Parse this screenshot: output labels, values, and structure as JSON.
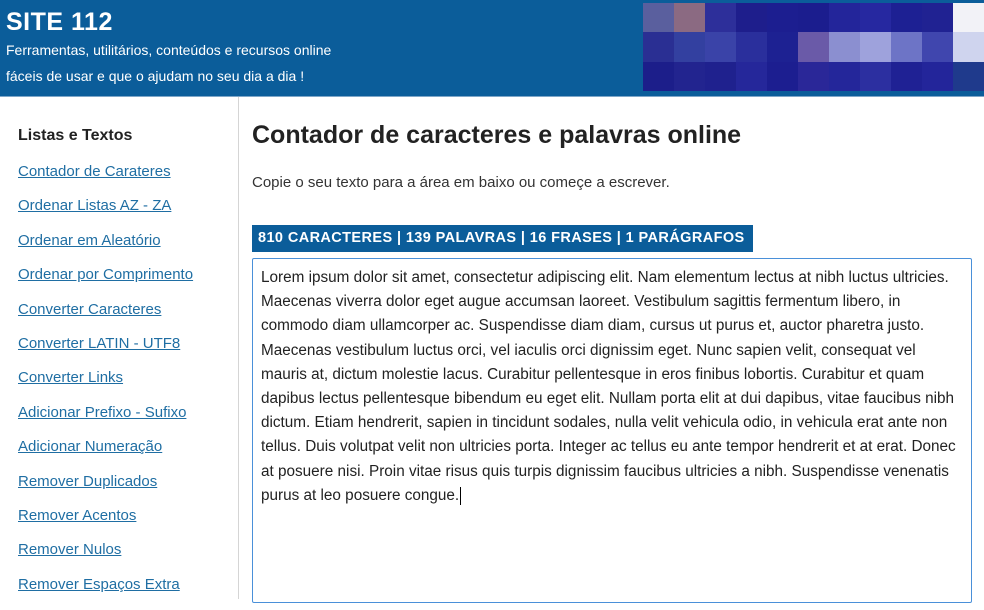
{
  "header": {
    "site_title": "SITE 112",
    "tagline_line1": "Ferramentas, utilitários, conteúdos e recursos online",
    "tagline_line2": "fáceis de usar e que o ajudam no seu dia a dia !",
    "colors": {
      "background": "#0b5d9a",
      "text": "#ffffff"
    }
  },
  "sidebar": {
    "heading": "Listas e Textos",
    "items": [
      {
        "label": "Contador de Carateres"
      },
      {
        "label": "Ordenar Listas AZ - ZA"
      },
      {
        "label": "Ordenar em Aleatório"
      },
      {
        "label": "Ordenar por Comprimento"
      },
      {
        "label": "Converter Caracteres"
      },
      {
        "label": "Converter LATIN - UTF8"
      },
      {
        "label": "Converter Links"
      },
      {
        "label": "Adicionar Prefixo - Sufixo"
      },
      {
        "label": "Adicionar Numeração"
      },
      {
        "label": "Remover Duplicados"
      },
      {
        "label": "Remover Acentos"
      },
      {
        "label": "Remover Nulos"
      },
      {
        "label": "Remover Espaços Extra"
      }
    ],
    "link_color": "#1f6ea3"
  },
  "main": {
    "title": "Contador de caracteres e palavras online",
    "subtitle": "Copie o seu texto para a área em baixo ou começe a escrever.",
    "stats": "810 CARACTERES | 139 PALAVRAS | 16 FRASES | 1 PARÁGRAFOS",
    "editor_text": "Lorem ipsum dolor sit amet, consectetur adipiscing elit. Nam elementum lectus at nibh luctus ultricies. Maecenas viverra dolor eget augue accumsan laoreet. Vestibulum sagittis fermentum libero, in commodo diam ullamcorper ac. Suspendisse diam diam, cursus ut purus et, auctor pharetra justo. Maecenas vestibulum luctus orci, vel iaculis orci dignissim eget. Nunc sapien velit, consequat vel mauris at, dictum molestie lacus. Curabitur pellentesque in eros finibus lobortis. Curabitur et quam dapibus lectus pellentesque bibendum eu eget elit. Nullam porta elit at dui dapibus, vitae faucibus nibh dictum. Etiam hendrerit, sapien in tincidunt sodales, nulla velit vehicula odio, in vehicula erat ante non tellus. Duis volutpat velit non ultricies porta. Integer ac tellus eu ante tempor hendrerit et at erat. Donec at posuere nisi. Proin vitae risus quis turpis dignissim faucibus ultricies a nibh. Suspendisse venenatis purus at leo posuere congue.",
    "accent_color": "#0b5d9a",
    "editor_border_color": "#4a90d9"
  }
}
